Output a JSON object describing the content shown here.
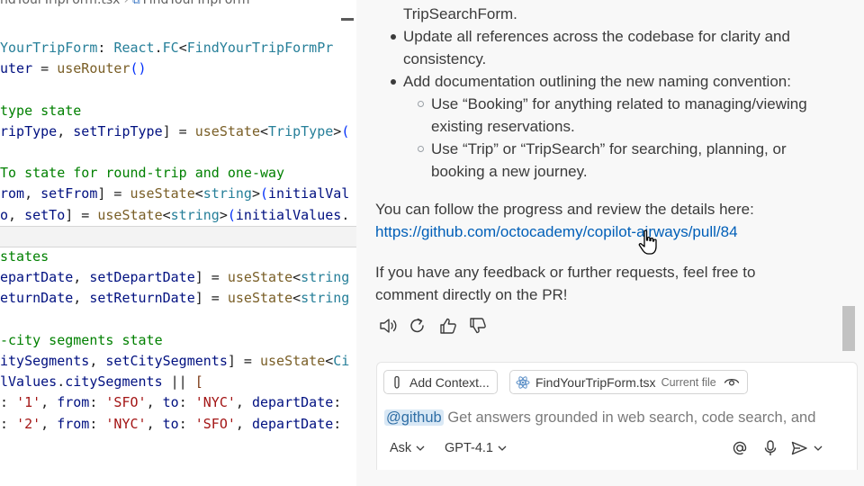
{
  "editor": {
    "breadcrumb": {
      "file_partial": "ndYourTripForm.tsx",
      "symbol_partial": "FindYourTripForm"
    },
    "lines": [
      [
        {
          "t": "YourTripForm",
          "c": "tk-ty"
        },
        {
          "t": ": ",
          "c": "tk-punc"
        },
        {
          "t": "React",
          "c": "tk-ty"
        },
        {
          "t": ".",
          "c": "tk-punc"
        },
        {
          "t": "FC",
          "c": "tk-ty"
        },
        {
          "t": "<",
          "c": "tk-punc"
        },
        {
          "t": "FindYourTripFormPr",
          "c": "tk-ty"
        }
      ],
      [
        {
          "t": "uter",
          "c": "tk-var"
        },
        {
          "t": " = ",
          "c": "tk-punc"
        },
        {
          "t": "useRouter",
          "c": "tk-fn"
        },
        {
          "t": "()",
          "c": "tk-br"
        }
      ],
      [],
      [
        {
          "t": "type state",
          "c": "tk-cm"
        }
      ],
      [
        {
          "t": "ripType",
          "c": "tk-var"
        },
        {
          "t": ", ",
          "c": "tk-punc"
        },
        {
          "t": "setTripType",
          "c": "tk-var"
        },
        {
          "t": "] = ",
          "c": "tk-punc"
        },
        {
          "t": "useState",
          "c": "tk-fn"
        },
        {
          "t": "<",
          "c": "tk-punc"
        },
        {
          "t": "TripType",
          "c": "tk-ty"
        },
        {
          "t": ">",
          "c": "tk-punc"
        },
        {
          "t": "(",
          "c": "tk-br"
        }
      ],
      [],
      [
        {
          "t": "To state for round-trip and one-way",
          "c": "tk-cm"
        }
      ],
      [
        {
          "t": "rom",
          "c": "tk-var"
        },
        {
          "t": ", ",
          "c": "tk-punc"
        },
        {
          "t": "setFrom",
          "c": "tk-var"
        },
        {
          "t": "] = ",
          "c": "tk-punc"
        },
        {
          "t": "useState",
          "c": "tk-fn"
        },
        {
          "t": "<",
          "c": "tk-punc"
        },
        {
          "t": "string",
          "c": "tk-ty"
        },
        {
          "t": ">",
          "c": "tk-punc"
        },
        {
          "t": "(",
          "c": "tk-br"
        },
        {
          "t": "initialVal",
          "c": "tk-var"
        }
      ],
      [
        {
          "t": "o",
          "c": "tk-var"
        },
        {
          "t": ", ",
          "c": "tk-punc"
        },
        {
          "t": "setTo",
          "c": "tk-var"
        },
        {
          "t": "] = ",
          "c": "tk-punc"
        },
        {
          "t": "useState",
          "c": "tk-fn"
        },
        {
          "t": "<",
          "c": "tk-punc"
        },
        {
          "t": "string",
          "c": "tk-ty"
        },
        {
          "t": ">",
          "c": "tk-punc"
        },
        {
          "t": "(",
          "c": "tk-br"
        },
        {
          "t": "initialValues",
          "c": "tk-var"
        },
        {
          "t": ".",
          "c": "tk-punc"
        }
      ],
      [],
      [
        {
          "t": "states",
          "c": "tk-cm"
        }
      ],
      [
        {
          "t": "epartDate",
          "c": "tk-var"
        },
        {
          "t": ", ",
          "c": "tk-punc"
        },
        {
          "t": "setDepartDate",
          "c": "tk-var"
        },
        {
          "t": "] = ",
          "c": "tk-punc"
        },
        {
          "t": "useState",
          "c": "tk-fn"
        },
        {
          "t": "<",
          "c": "tk-punc"
        },
        {
          "t": "string",
          "c": "tk-ty"
        }
      ],
      [
        {
          "t": "eturnDate",
          "c": "tk-var"
        },
        {
          "t": ", ",
          "c": "tk-punc"
        },
        {
          "t": "setReturnDate",
          "c": "tk-var"
        },
        {
          "t": "] = ",
          "c": "tk-punc"
        },
        {
          "t": "useState",
          "c": "tk-fn"
        },
        {
          "t": "<",
          "c": "tk-punc"
        },
        {
          "t": "string",
          "c": "tk-ty"
        }
      ],
      [],
      [
        {
          "t": "-city segments state",
          "c": "tk-cm"
        }
      ],
      [
        {
          "t": "itySegments",
          "c": "tk-var"
        },
        {
          "t": ", ",
          "c": "tk-punc"
        },
        {
          "t": "setCitySegments",
          "c": "tk-var"
        },
        {
          "t": "] = ",
          "c": "tk-punc"
        },
        {
          "t": "useState",
          "c": "tk-fn"
        },
        {
          "t": "<",
          "c": "tk-punc"
        },
        {
          "t": "Ci",
          "c": "tk-ty"
        }
      ],
      [
        {
          "t": "lValues",
          "c": "tk-var"
        },
        {
          "t": ".",
          "c": "tk-punc"
        },
        {
          "t": "citySegments",
          "c": "tk-var"
        },
        {
          "t": " || ",
          "c": "tk-punc"
        },
        {
          "t": "[",
          "c": "tk-br3"
        }
      ],
      [
        {
          "t": ": ",
          "c": "tk-punc"
        },
        {
          "t": "'1'",
          "c": "tk-str"
        },
        {
          "t": ", ",
          "c": "tk-punc"
        },
        {
          "t": "from",
          "c": "tk-var"
        },
        {
          "t": ": ",
          "c": "tk-punc"
        },
        {
          "t": "'SFO'",
          "c": "tk-str"
        },
        {
          "t": ", ",
          "c": "tk-punc"
        },
        {
          "t": "to",
          "c": "tk-var"
        },
        {
          "t": ": ",
          "c": "tk-punc"
        },
        {
          "t": "'NYC'",
          "c": "tk-str"
        },
        {
          "t": ", ",
          "c": "tk-punc"
        },
        {
          "t": "departDate",
          "c": "tk-var"
        },
        {
          "t": ":",
          "c": "tk-punc"
        }
      ],
      [
        {
          "t": ": ",
          "c": "tk-punc"
        },
        {
          "t": "'2'",
          "c": "tk-str"
        },
        {
          "t": ", ",
          "c": "tk-punc"
        },
        {
          "t": "from",
          "c": "tk-var"
        },
        {
          "t": ": ",
          "c": "tk-punc"
        },
        {
          "t": "'NYC'",
          "c": "tk-str"
        },
        {
          "t": ", ",
          "c": "tk-punc"
        },
        {
          "t": "to",
          "c": "tk-var"
        },
        {
          "t": ": ",
          "c": "tk-punc"
        },
        {
          "t": "'SFO'",
          "c": "tk-str"
        },
        {
          "t": ", ",
          "c": "tk-punc"
        },
        {
          "t": "departDate",
          "c": "tk-var"
        },
        {
          "t": ":",
          "c": "tk-punc"
        }
      ]
    ]
  },
  "chat": {
    "lines": {
      "l0": "TripSearchForm.",
      "l1": "Update all references across the codebase for clarity and",
      "l1b": "consistency.",
      "l2": "Add documentation outlining the new naming convention:",
      "l3": "Use “Booking” for anything related to managing/viewing",
      "l3b": "existing reservations.",
      "l4": "Use “Trip” or “TripSearch” for searching, planning, or",
      "l4b": "booking a new journey.",
      "follow": "You can follow the progress and review the details here:",
      "link": "https://github.com/octocademy/copilot-airways/pull/84",
      "feedback1": "If you have any feedback or further requests, feel free to",
      "feedback2": "comment directly on the PR!"
    },
    "actions": {
      "read_aloud": "speaker-icon",
      "retry": "refresh-icon",
      "helpful": "thumbs-up-icon",
      "unhelpful": "thumbs-down-icon"
    },
    "input": {
      "add_context_label": "Add Context...",
      "file_chip_label": "FindYourTripForm.tsx",
      "file_chip_sub": "Current file",
      "mention": "@github",
      "placeholder": "Get answers grounded in web search, code search, and",
      "mode_label": "Ask",
      "model_label": "GPT-4.1"
    }
  },
  "colors": {
    "link": "#005fb8",
    "mention_bg": "#d9e8f5",
    "chat_bg": "#f8f8f8"
  }
}
